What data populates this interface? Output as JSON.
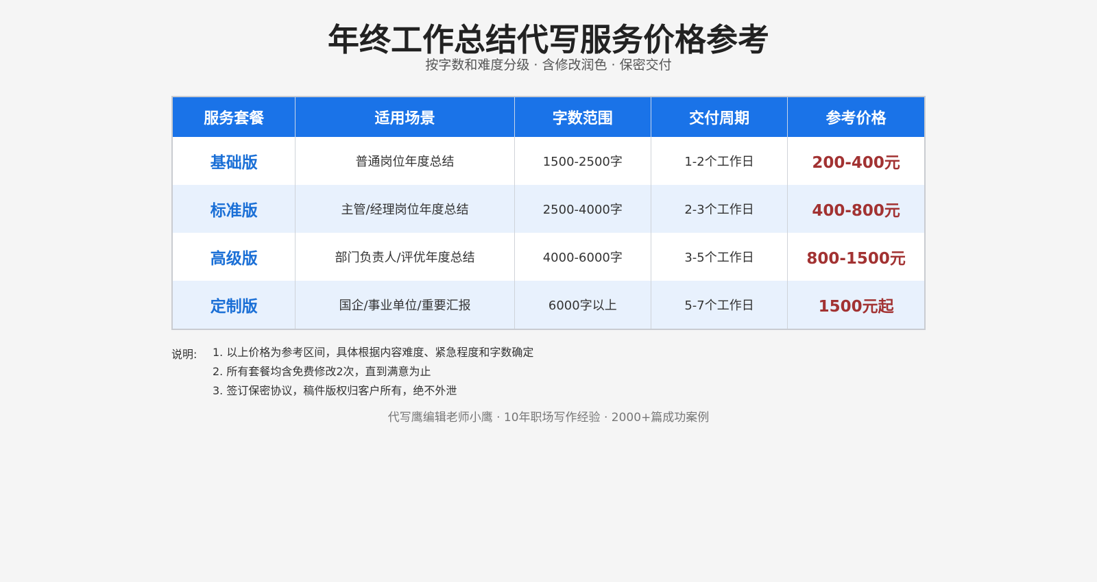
{
  "header": {
    "title": "年终工作总结代写服务价格参考",
    "subtitle": "按字数和难度分级 · 含修改润色 · 保密交付"
  },
  "table": {
    "columns": [
      "服务套餐",
      "适用场景",
      "字数范围",
      "交付周期",
      "参考价格"
    ],
    "rows": [
      {
        "package": "基础版",
        "scenario": "普通岗位年度总结",
        "words": "1500-2500字",
        "delivery": "1-2个工作日",
        "price": "200-400元"
      },
      {
        "package": "标准版",
        "scenario": "主管/经理岗位年度总结",
        "words": "2500-4000字",
        "delivery": "2-3个工作日",
        "price": "400-800元"
      },
      {
        "package": "高级版",
        "scenario": "部门负责人/评优年度总结",
        "words": "4000-6000字",
        "delivery": "3-5个工作日",
        "price": "800-1500元"
      },
      {
        "package": "定制版",
        "scenario": "国企/事业单位/重要汇报",
        "words": "6000字以上",
        "delivery": "5-7个工作日",
        "price": "1500元起"
      }
    ]
  },
  "notes": {
    "label": "说明:",
    "items": [
      "1. 以上价格为参考区间，具体根据内容难度、紧急程度和字数确定",
      "2. 所有套餐均含免费修改2次，直到满意为止",
      "3. 签订保密协议，稿件版权归客户所有，绝不外泄"
    ]
  },
  "footer": {
    "text": "代写鹰编辑老师小鹰 · 10年职场写作经验 · 2000+篇成功案例"
  },
  "colors": {
    "header_bg": "#1a73e8",
    "package_text": "#1a6fd6",
    "price_text": "#a23232",
    "alt_row_bg": "#e8f1fd",
    "page_bg": "#f5f5f5"
  }
}
